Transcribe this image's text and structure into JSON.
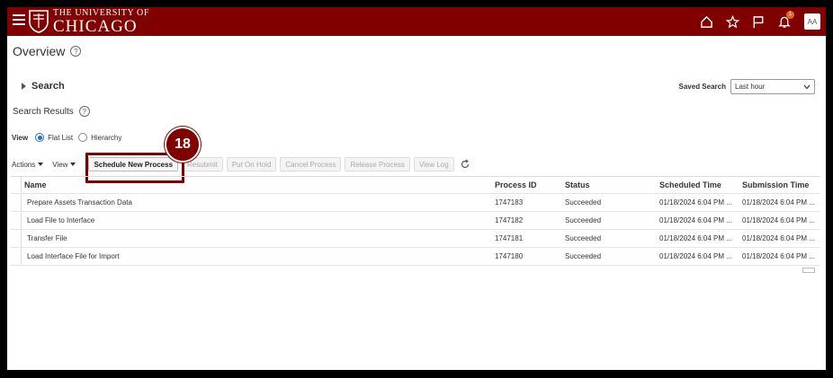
{
  "header": {
    "logo_line1": "THE UNIVERSITY OF",
    "logo_line2": "CHICAGO",
    "notification_count": "1",
    "avatar_initials": "AA",
    "brand_color": "#800000"
  },
  "page": {
    "title": "Overview",
    "search_label": "Search",
    "saved_search_label": "Saved Search",
    "saved_search_value": "Last hour",
    "results_title": "Search Results"
  },
  "view": {
    "label": "View",
    "flat_list": "Flat List",
    "hierarchy": "Hierarchy",
    "selected": "flat_list"
  },
  "toolbar": {
    "actions": "Actions",
    "view": "View",
    "schedule_new_process": "Schedule New Process",
    "resubmit": "Resubmit",
    "put_on_hold": "Put On Hold",
    "cancel_process": "Cancel Process",
    "release_process": "Release Process",
    "view_log": "View Log"
  },
  "callout": {
    "step": "18"
  },
  "table": {
    "headers": {
      "name": "Name",
      "process_id": "Process ID",
      "status": "Status",
      "scheduled_time": "Scheduled Time",
      "submission_time": "Submission Time"
    },
    "rows": [
      {
        "name": "Prepare Assets Transaction Data",
        "process_id": "1747183",
        "status": "Succeeded",
        "scheduled_time": "01/18/2024 6:04 PM ...",
        "submission_time": "01/18/2024 6:04 PM ..."
      },
      {
        "name": "Load File to Interface",
        "process_id": "1747182",
        "status": "Succeeded",
        "scheduled_time": "01/18/2024 6:04 PM ...",
        "submission_time": "01/18/2024 6:04 PM ..."
      },
      {
        "name": "Transfer File",
        "process_id": "1747181",
        "status": "Succeeded",
        "scheduled_time": "01/18/2024 6:04 PM ...",
        "submission_time": "01/18/2024 6:04 PM ..."
      },
      {
        "name": "Load Interface File for Import",
        "process_id": "1747180",
        "status": "Succeeded",
        "scheduled_time": "01/18/2024 6:04 PM ...",
        "submission_time": "01/18/2024 6:04 PM ..."
      }
    ]
  }
}
